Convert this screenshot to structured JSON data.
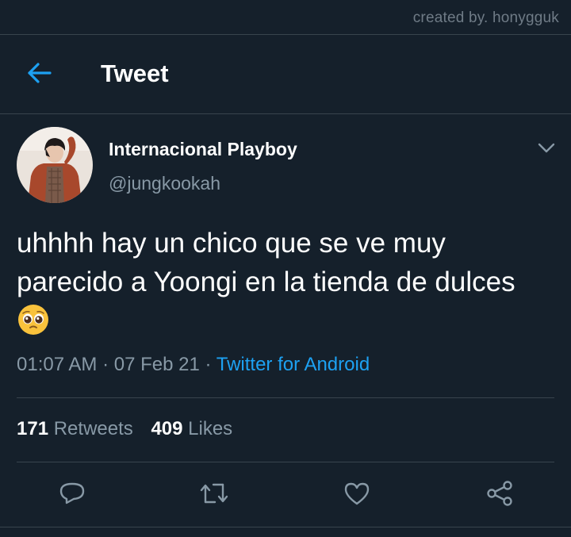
{
  "watermark": "created by. honygguk",
  "header": {
    "title": "Tweet",
    "back_icon": "arrow-left-icon"
  },
  "tweet": {
    "author": {
      "display_name": "Internacional Playboy",
      "handle": "@jungkookah"
    },
    "text": "uhhhh hay un chico que se ve muy parecido a Yoongi en la tienda de dulces",
    "emoji": "pleading-face-emoji",
    "time": "01:07 AM",
    "date": "07 Feb 21",
    "separator": "·",
    "source": "Twitter for Android",
    "stats": {
      "retweets_count": "171",
      "retweets_label": "Retweets",
      "likes_count": "409",
      "likes_label": "Likes"
    },
    "actions": [
      "reply-icon",
      "retweet-icon",
      "like-icon",
      "share-icon"
    ]
  },
  "colors": {
    "background": "#15202b",
    "divider": "#38444d",
    "accent": "#1da1f2",
    "secondary_text": "#8899a6",
    "primary_text": "#ffffff"
  }
}
